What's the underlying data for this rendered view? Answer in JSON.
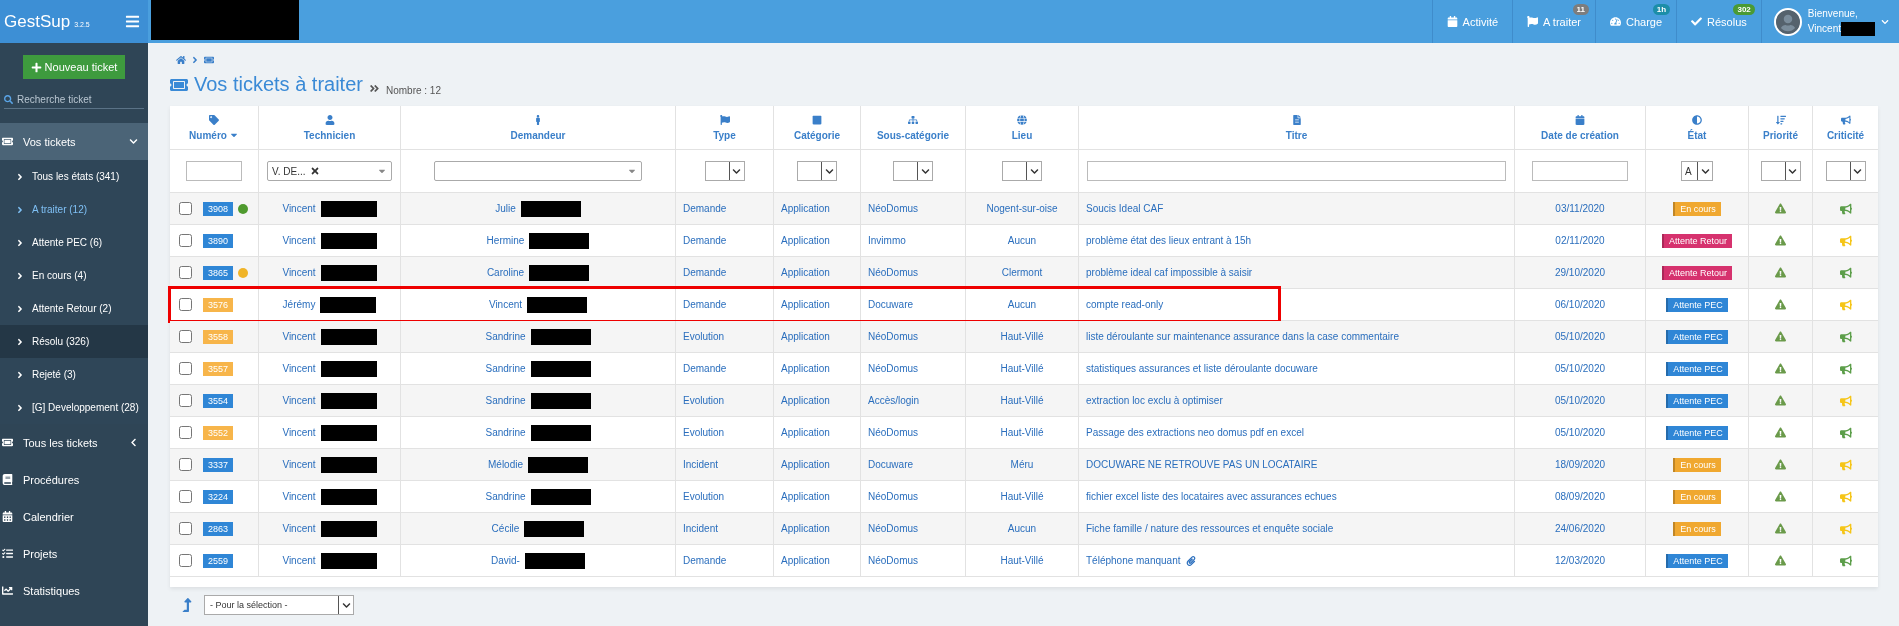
{
  "app": {
    "name": "GestSup",
    "version": "3.2.5"
  },
  "sidebar": {
    "new_button": "Nouveau ticket",
    "search": {
      "placeholder": "Recherche ticket"
    },
    "items": [
      {
        "label": "Vos tickets",
        "expanded": true,
        "children": [
          {
            "label": "Tous les états (341)",
            "selected": false,
            "hovered": false
          },
          {
            "label": "A traiter (12)",
            "selected": true,
            "hovered": false
          },
          {
            "label": "Attente PEC (6)",
            "selected": false,
            "hovered": false
          },
          {
            "label": "En cours (4)",
            "selected": false,
            "hovered": false
          },
          {
            "label": "Attente Retour (2)",
            "selected": false,
            "hovered": false
          },
          {
            "label": "Résolu (326)",
            "selected": false,
            "hovered": true
          },
          {
            "label": "Rejeté (3)",
            "selected": false,
            "hovered": false
          },
          {
            "label": "[G] Developpement (28)",
            "selected": false,
            "hovered": false
          }
        ]
      },
      {
        "label": "Tous les tickets",
        "expanded": false
      },
      {
        "label": "Procédures"
      },
      {
        "label": "Calendrier"
      },
      {
        "label": "Projets"
      },
      {
        "label": "Statistiques"
      }
    ]
  },
  "topbar": {
    "menu": [
      {
        "label": "Activité"
      },
      {
        "label": "A traiter",
        "badge": {
          "text": "11",
          "color": "#7d7d7d"
        }
      },
      {
        "label": "Charge",
        "badge": {
          "text": "1h",
          "color": "#1c8ea8"
        }
      },
      {
        "label": "Résolus",
        "badge": {
          "text": "302",
          "color": "#4a9a34"
        }
      }
    ],
    "user": {
      "greeting": "Bienvenue,",
      "name": "Vincent"
    }
  },
  "page": {
    "title": "Vos tickets à traiter",
    "count": "Nombre : 12"
  },
  "table": {
    "columns": [
      {
        "label": "Numéro",
        "sorted": true
      },
      {
        "label": "Technicien",
        "sorted": false
      },
      {
        "label": "Demandeur",
        "sorted": false
      },
      {
        "label": "Type",
        "sorted": false
      },
      {
        "label": "Catégorie",
        "sorted": false
      },
      {
        "label": "Sous-catégorie",
        "sorted": false
      },
      {
        "label": "Lieu",
        "sorted": false
      },
      {
        "label": "Titre",
        "sorted": false
      },
      {
        "label": "Date de création",
        "sorted": false
      },
      {
        "label": "État",
        "sorted": false
      },
      {
        "label": "Priorité",
        "sorted": false
      },
      {
        "label": "Criticité",
        "sorted": false
      }
    ],
    "filters": [
      {
        "kind": "input"
      },
      {
        "kind": "select",
        "value": "V. DE...",
        "clearable": true
      },
      {
        "kind": "select",
        "clearable": false
      },
      {
        "kind": "mini"
      },
      {
        "kind": "mini"
      },
      {
        "kind": "mini"
      },
      {
        "kind": "mini"
      },
      {
        "kind": "input"
      },
      {
        "kind": "input"
      },
      {
        "kind": "mini",
        "value": "A"
      },
      {
        "kind": "mini"
      },
      {
        "kind": "mini"
      }
    ],
    "rows": [
      {
        "number": {
          "text": "3908",
          "color": "#2f86d6"
        },
        "dot": {
          "color": "#4f9a2e"
        },
        "checked": false,
        "annotated": false,
        "technician": "Vincent",
        "requester": "Julie",
        "type": "Demande",
        "category": "Application",
        "subcategory": "NéoDomus",
        "place": "Nogent-sur-oise",
        "title": "Soucis Ideal CAF",
        "attachment": false,
        "date": "03/11/2020",
        "state": {
          "label": "En cours",
          "color": "#f0a830"
        },
        "criticality": {
          "color": "#5c9e4a"
        }
      },
      {
        "number": {
          "text": "3890",
          "color": "#2f86d6"
        },
        "checked": false,
        "annotated": false,
        "technician": "Vincent",
        "requester": "Hermine",
        "type": "Demande",
        "category": "Application",
        "subcategory": "Invimmo",
        "place": "Aucun",
        "title": "problème état des lieux entrant à 15h",
        "attachment": false,
        "date": "02/11/2020",
        "state": {
          "label": "Attente Retour",
          "color": "#d6326e"
        },
        "criticality": {
          "color": "#f5c518"
        }
      },
      {
        "number": {
          "text": "3865",
          "color": "#2f86d6"
        },
        "dot": {
          "color": "#f0b428"
        },
        "checked": false,
        "annotated": false,
        "technician": "Vincent",
        "requester": "Caroline",
        "type": "Demande",
        "category": "Application",
        "subcategory": "NéoDomus",
        "place": "Clermont",
        "title": "problème ideal caf impossible à saisir",
        "attachment": false,
        "date": "29/10/2020",
        "state": {
          "label": "Attente Retour",
          "color": "#d6326e"
        },
        "criticality": {
          "color": "#5c9e4a"
        }
      },
      {
        "number": {
          "text": "3576",
          "color": "#f7b54a"
        },
        "checked": false,
        "annotated": true,
        "technician": "Jérémy",
        "requester": "Vincent",
        "type": "Demande",
        "category": "Application",
        "subcategory": "Docuware",
        "place": "Aucun",
        "title": "compte read-only",
        "attachment": false,
        "date": "06/10/2020",
        "state": {
          "label": "Attente PEC",
          "color": "#2f86d6"
        },
        "criticality": {
          "color": "#f5c518"
        }
      },
      {
        "number": {
          "text": "3558",
          "color": "#f7b54a"
        },
        "checked": false,
        "annotated": false,
        "technician": "Vincent",
        "requester": "Sandrine",
        "type": "Evolution",
        "category": "Application",
        "subcategory": "NéoDomus",
        "place": "Haut-Villé",
        "title": "liste déroulante sur maintenance assurance dans la case commentaire",
        "attachment": false,
        "date": "05/10/2020",
        "state": {
          "label": "Attente PEC",
          "color": "#2f86d6"
        },
        "criticality": {
          "color": "#5c9e4a"
        }
      },
      {
        "number": {
          "text": "3557",
          "color": "#f7b54a"
        },
        "checked": false,
        "annotated": false,
        "technician": "Vincent",
        "requester": "Sandrine",
        "type": "Demande",
        "category": "Application",
        "subcategory": "NéoDomus",
        "place": "Haut-Villé",
        "title": "statistiques assurances et liste déroulante docuware",
        "attachment": false,
        "date": "05/10/2020",
        "state": {
          "label": "Attente PEC",
          "color": "#2f86d6"
        },
        "criticality": {
          "color": "#5c9e4a"
        }
      },
      {
        "number": {
          "text": "3554",
          "color": "#2f86d6"
        },
        "checked": false,
        "annotated": false,
        "technician": "Vincent",
        "requester": "Sandrine",
        "type": "Evolution",
        "category": "Application",
        "subcategory": "Accès/login",
        "place": "Haut-Villé",
        "title": "extraction loc exclu à optimiser",
        "attachment": false,
        "date": "05/10/2020",
        "state": {
          "label": "Attente PEC",
          "color": "#2f86d6"
        },
        "criticality": {
          "color": "#f5c518"
        }
      },
      {
        "number": {
          "text": "3552",
          "color": "#f7b54a"
        },
        "checked": false,
        "annotated": false,
        "technician": "Vincent",
        "requester": "Sandrine",
        "type": "Evolution",
        "category": "Application",
        "subcategory": "NéoDomus",
        "place": "Haut-Villé",
        "title": "Passage des extractions neo domus pdf en excel",
        "attachment": false,
        "date": "05/10/2020",
        "state": {
          "label": "Attente PEC",
          "color": "#2f86d6"
        },
        "criticality": {
          "color": "#5c9e4a"
        }
      },
      {
        "number": {
          "text": "3337",
          "color": "#2f86d6"
        },
        "checked": false,
        "annotated": false,
        "technician": "Vincent",
        "requester": "Mélodie",
        "type": "Incident",
        "category": "Application",
        "subcategory": "Docuware",
        "place": "Méru",
        "title": "DOCUWARE NE RETROUVE PAS UN LOCATAIRE",
        "attachment": false,
        "date": "18/09/2020",
        "state": {
          "label": "En cours",
          "color": "#f0a830"
        },
        "criticality": {
          "color": "#f5c518"
        }
      },
      {
        "number": {
          "text": "3224",
          "color": "#2f86d6"
        },
        "checked": false,
        "annotated": false,
        "technician": "Vincent",
        "requester": "Sandrine",
        "type": "Evolution",
        "category": "Application",
        "subcategory": "NéoDomus",
        "place": "Haut-Villé",
        "title": "fichier excel liste des locataires avec assurances echues",
        "attachment": false,
        "date": "08/09/2020",
        "state": {
          "label": "En cours",
          "color": "#f0a830"
        },
        "criticality": {
          "color": "#f5c518"
        }
      },
      {
        "number": {
          "text": "2863",
          "color": "#2f86d6"
        },
        "checked": false,
        "annotated": false,
        "technician": "Vincent",
        "requester": "Cécile",
        "type": "Incident",
        "category": "Application",
        "subcategory": "NéoDomus",
        "place": "Aucun",
        "title": "Fiche famille / nature des ressources et enquête sociale",
        "attachment": false,
        "date": "24/06/2020",
        "state": {
          "label": "En cours",
          "color": "#f0a830"
        },
        "criticality": {
          "color": "#f5c518"
        }
      },
      {
        "number": {
          "text": "2559",
          "color": "#2f86d6"
        },
        "checked": false,
        "annotated": false,
        "technician": "Vincent",
        "requester": "David-",
        "type": "Demande",
        "category": "Application",
        "subcategory": "NéoDomus",
        "place": "Haut-Villé",
        "title": "Téléphone manquant",
        "attachment": true,
        "date": "12/03/2020",
        "state": {
          "label": "Attente PEC",
          "color": "#2f86d6"
        },
        "criticality": {
          "color": "#5c9e4a"
        }
      }
    ]
  },
  "bulk_action": {
    "placeholder": "- Pour la sélection -"
  }
}
